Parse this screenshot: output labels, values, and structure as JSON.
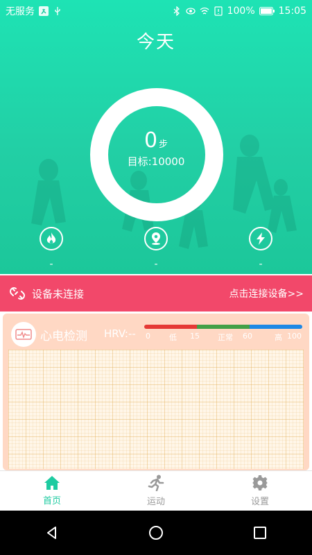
{
  "status_bar": {
    "carrier": "无服务",
    "battery": "100%",
    "time": "15:05"
  },
  "header": {
    "title": "今天"
  },
  "steps": {
    "count": "0",
    "unit": "步",
    "goal_label": "目标:10000"
  },
  "metrics": [
    {
      "icon": "flame-icon",
      "value": "-"
    },
    {
      "icon": "location-pin-icon",
      "value": "-"
    },
    {
      "icon": "lightning-icon",
      "value": "-"
    }
  ],
  "device_banner": {
    "status": "设备未连接",
    "action": "点击连接设备>>"
  },
  "ecg": {
    "title": "心电检测",
    "hrv_label": "HRV:--",
    "scale": {
      "min": "0",
      "low_label": "低",
      "v15": "15",
      "normal_label": "正常",
      "v60": "60",
      "high_label": "高",
      "max": "100"
    },
    "colors": {
      "low": "#e53935",
      "normal": "#43a047",
      "high": "#1e88e5"
    }
  },
  "tabs": [
    {
      "label": "首页",
      "active": true
    },
    {
      "label": "运动",
      "active": false
    },
    {
      "label": "设置",
      "active": false
    }
  ],
  "colors": {
    "primary": "#1ecba1",
    "banner": "#f2486a"
  }
}
